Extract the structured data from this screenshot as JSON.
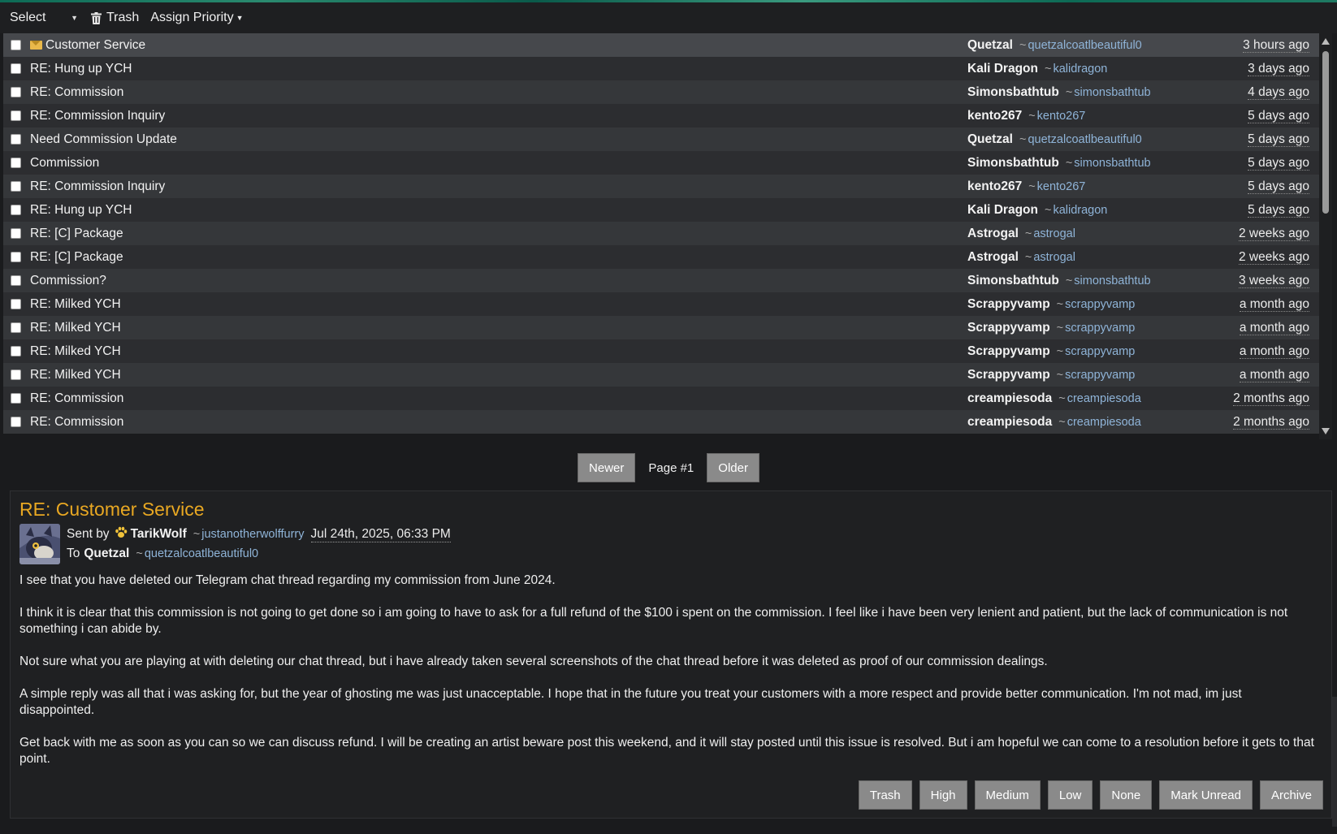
{
  "toolbar": {
    "select_label": "Select",
    "trash_label": "Trash",
    "assign_priority_label": "Assign Priority"
  },
  "messages": [
    {
      "subject": "Customer Service",
      "name": "Quetzal",
      "handle": "quetzalcoatlbeautiful0",
      "when": "3 hours ago",
      "unread": true
    },
    {
      "subject": "RE: Hung up YCH",
      "name": "Kali Dragon",
      "handle": "kalidragon",
      "when": "3 days ago"
    },
    {
      "subject": "RE: Commission",
      "name": "Simonsbathtub",
      "handle": "simonsbathtub",
      "when": "4 days ago"
    },
    {
      "subject": "RE: Commission Inquiry",
      "name": "kento267",
      "handle": "kento267",
      "when": "5 days ago"
    },
    {
      "subject": "Need Commission Update",
      "name": "Quetzal",
      "handle": "quetzalcoatlbeautiful0",
      "when": "5 days ago"
    },
    {
      "subject": "Commission",
      "name": "Simonsbathtub",
      "handle": "simonsbathtub",
      "when": "5 days ago"
    },
    {
      "subject": "RE: Commission Inquiry",
      "name": "kento267",
      "handle": "kento267",
      "when": "5 days ago"
    },
    {
      "subject": "RE: Hung up YCH",
      "name": "Kali Dragon",
      "handle": "kalidragon",
      "when": "5 days ago"
    },
    {
      "subject": "RE: [C] Package",
      "name": "Astrogal",
      "handle": "astrogal",
      "when": "2 weeks ago"
    },
    {
      "subject": "RE: [C] Package",
      "name": "Astrogal",
      "handle": "astrogal",
      "when": "2 weeks ago"
    },
    {
      "subject": "Commission?",
      "name": "Simonsbathtub",
      "handle": "simonsbathtub",
      "when": "3 weeks ago"
    },
    {
      "subject": "RE: Milked YCH",
      "name": "Scrappyvamp",
      "handle": "scrappyvamp",
      "when": "a month ago"
    },
    {
      "subject": "RE: Milked YCH",
      "name": "Scrappyvamp",
      "handle": "scrappyvamp",
      "when": "a month ago"
    },
    {
      "subject": "RE: Milked YCH",
      "name": "Scrappyvamp",
      "handle": "scrappyvamp",
      "when": "a month ago"
    },
    {
      "subject": "RE: Milked YCH",
      "name": "Scrappyvamp",
      "handle": "scrappyvamp",
      "when": "a month ago"
    },
    {
      "subject": "RE: Commission",
      "name": "creampiesoda",
      "handle": "creampiesoda",
      "when": "2 months ago"
    },
    {
      "subject": "RE: Commission",
      "name": "creampiesoda",
      "handle": "creampiesoda",
      "when": "2 months ago"
    }
  ],
  "pager": {
    "newer_label": "Newer",
    "page_label": "Page #1",
    "older_label": "Older"
  },
  "message": {
    "title": "RE: Customer Service",
    "sent_by_label": "Sent by",
    "sender_name": "TarikWolf",
    "sender_handle": "justanotherwolffurry",
    "date": "Jul 24th, 2025, 06:33 PM",
    "to_label": "To",
    "recipient_name": "Quetzal",
    "recipient_handle": "quetzalcoatlbeautiful0",
    "paragraphs": [
      "I see that you have deleted our Telegram chat thread regarding my commission from June 2024.",
      "I think it is clear that this commission is not going to get done so i am going to have to ask for a full refund of the $100 i spent on the commission. I feel like i have been very lenient and patient, but the lack of communication is not something i can abide by.",
      "Not sure what you are playing at with deleting our chat thread, but i have already taken several screenshots of the chat thread before it was deleted as proof of our commission dealings.",
      "A simple reply was all that i was asking for, but the year of ghosting me was just unacceptable. I hope that in the future you treat your customers with a more respect and provide better communication. I'm not mad, im just disappointed.",
      "Get back with me as soon as you can so we can discuss refund. I will be creating an artist beware post this weekend, and it will stay posted until this issue is resolved. But i am hopeful we can come to a resolution before it gets to that point."
    ]
  },
  "actions": {
    "trash": "Trash",
    "high": "High",
    "medium": "Medium",
    "low": "Low",
    "none": "None",
    "mark_unread": "Mark Unread",
    "archive": "Archive"
  },
  "colors": {
    "title_accent": "#e9a822",
    "handle_link": "#8fb4d8",
    "button_bg": "#8a8a8a"
  }
}
